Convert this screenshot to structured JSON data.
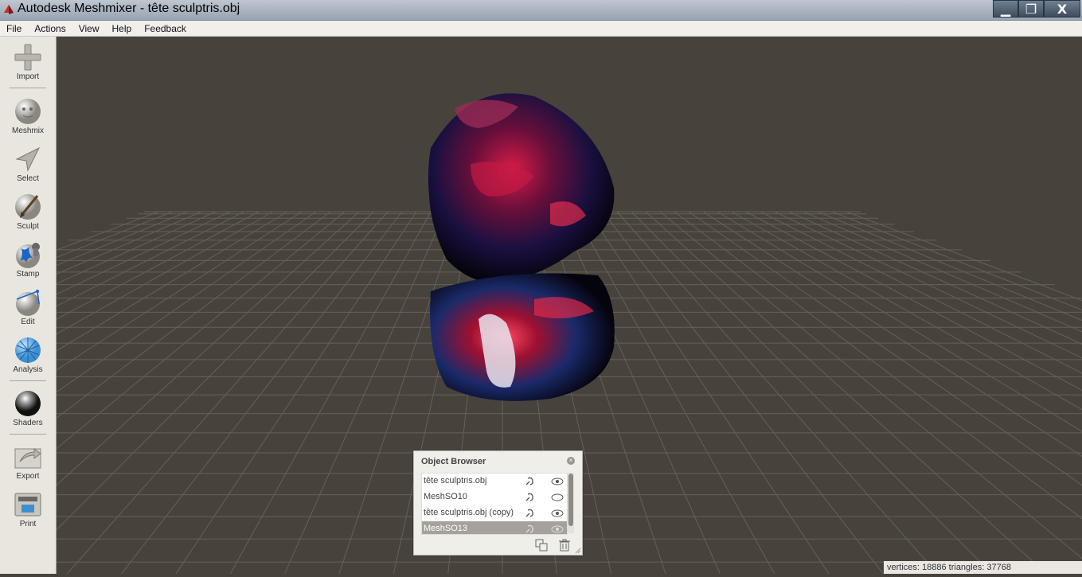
{
  "window": {
    "title": "Autodesk Meshmixer - tête sculptris.obj",
    "minimize_symbol": "▁",
    "restore_symbol": "❐",
    "close_symbol": "X"
  },
  "menu": [
    "File",
    "Actions",
    "View",
    "Help",
    "Feedback"
  ],
  "tools": [
    {
      "label": "Import",
      "icon": "plus-icon"
    },
    {
      "label": "Meshmix",
      "icon": "meshmix-sphere-icon"
    },
    {
      "label": "Select",
      "icon": "arrow-cursor-icon"
    },
    {
      "label": "Sculpt",
      "icon": "brush-sphere-icon"
    },
    {
      "label": "Stamp",
      "icon": "stamp-sphere-icon"
    },
    {
      "label": "Edit",
      "icon": "edit-sphere-icon"
    },
    {
      "label": "Analysis",
      "icon": "mesh-sphere-icon"
    },
    {
      "label": "Shaders",
      "icon": "chrome-sphere-icon"
    },
    {
      "label": "Export",
      "icon": "export-icon"
    },
    {
      "label": "Print",
      "icon": "printer-icon"
    }
  ],
  "object_browser": {
    "title": "Object Browser",
    "close_symbol": "×",
    "items": [
      {
        "name": "tête sculptris.obj",
        "selected": false,
        "visible": true
      },
      {
        "name": "MeshSO10",
        "selected": false,
        "visible": false
      },
      {
        "name": "tête sculptris.obj (copy)",
        "selected": false,
        "visible": true
      },
      {
        "name": "MeshSO13",
        "selected": true,
        "visible": true
      }
    ]
  },
  "status": {
    "text": "vertices: 18886 triangles: 37768"
  },
  "colors": {
    "viewport_bg": "#47433c",
    "grid": "#6a665f",
    "mesh_accent": "#c8123c",
    "mesh_dark": "#0b0618"
  }
}
